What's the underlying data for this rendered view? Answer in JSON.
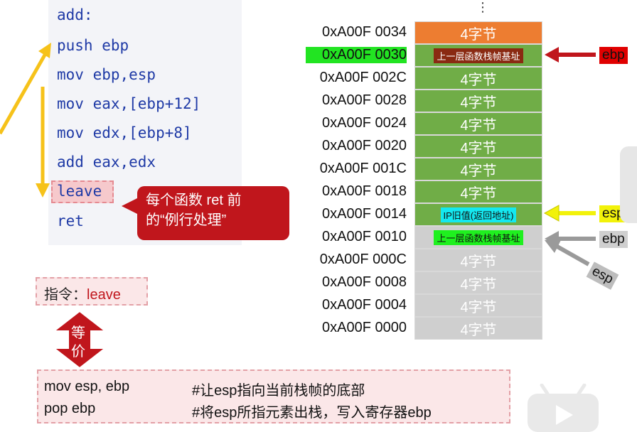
{
  "code": {
    "lines": [
      "add:",
      "push ebp",
      "mov ebp,esp",
      "mov eax,[ebp+12]",
      "mov edx,[ebp+8]",
      "add eax,edx",
      "leave",
      "ret"
    ]
  },
  "callout": {
    "line1": "每个函数 ret 前",
    "line2": "的“例行处理”"
  },
  "instruction": {
    "label": "指令：",
    "value": "leave"
  },
  "equivalent": {
    "label_top": "等",
    "label_bottom": "价"
  },
  "equiv_lines": [
    {
      "code": "mov esp, ebp",
      "comment": "#让esp指向当前栈帧的底部"
    },
    {
      "code": "pop ebp",
      "comment": "#将esp所指元素出栈，写入寄存器ebp"
    }
  ],
  "stack": {
    "rows": [
      {
        "addr": "0xA00F 0034",
        "content": "4字节",
        "kind": "orange"
      },
      {
        "addr": "0xA00F 0030",
        "content": "上一层函数栈帧基址",
        "kind": "green",
        "addr_highlight": true,
        "label_style": "dark-red-small"
      },
      {
        "addr": "0xA00F 002C",
        "content": "4字节",
        "kind": "green"
      },
      {
        "addr": "0xA00F 0028",
        "content": "4字节",
        "kind": "green"
      },
      {
        "addr": "0xA00F 0024",
        "content": "4字节",
        "kind": "green"
      },
      {
        "addr": "0xA00F 0020",
        "content": "4字节",
        "kind": "green"
      },
      {
        "addr": "0xA00F 001C",
        "content": "4字节",
        "kind": "green"
      },
      {
        "addr": "0xA00F 0018",
        "content": "4字节",
        "kind": "green"
      },
      {
        "addr": "0xA00F 0014",
        "content": "IP旧值(返回地址)",
        "kind": "green",
        "label_style": "cyan-small"
      },
      {
        "addr": "0xA00F 0010",
        "content": "上一层函数栈帧基址",
        "kind": "gray",
        "label_style": "lime-small"
      },
      {
        "addr": "0xA00F 000C",
        "content": "4字节",
        "kind": "gray"
      },
      {
        "addr": "0xA00F 0008",
        "content": "4字节",
        "kind": "gray"
      },
      {
        "addr": "0xA00F 0004",
        "content": "4字节",
        "kind": "gray"
      },
      {
        "addr": "0xA00F 0000",
        "content": "4字节",
        "kind": "gray"
      }
    ]
  },
  "pointers": {
    "ebp_old": "ebp",
    "esp_new": "esp",
    "ebp_new": "ebp",
    "esp_old": "esp"
  },
  "colors": {
    "orange": "#ed7d31",
    "green": "#70ad47",
    "gray": "#cfcfcf",
    "red": "#c0161c",
    "yellow": "#f6c21a",
    "code_blue": "#1f3aa6"
  }
}
